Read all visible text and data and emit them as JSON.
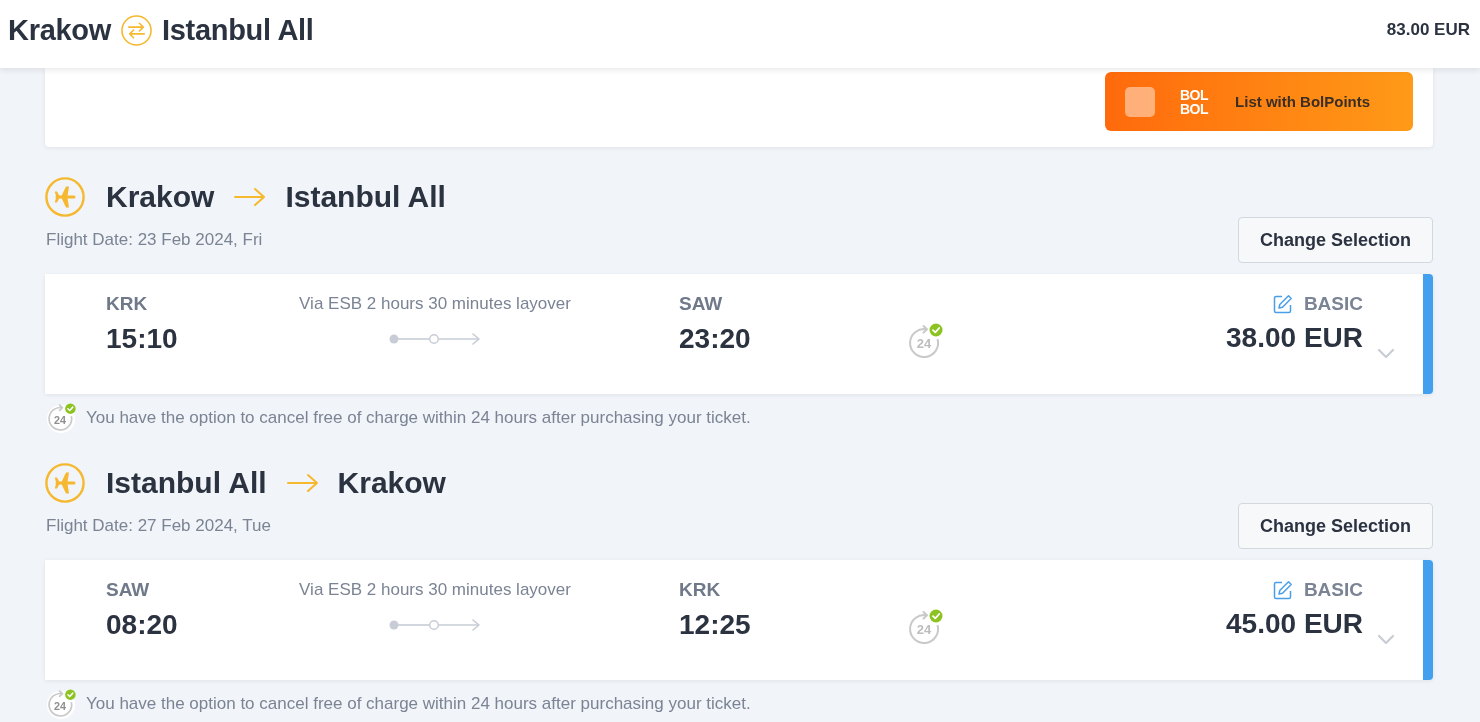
{
  "header": {
    "origin": "Krakow",
    "destination": "Istanbul All",
    "total": "83.00 EUR"
  },
  "bolpoints": {
    "logo_lines": [
      "BOL",
      "BOL"
    ],
    "button": "List with BolPoints"
  },
  "legs": [
    {
      "origin": "Krakow",
      "destination": "Istanbul All",
      "date": "Flight Date: 23 Feb 2024, Fri",
      "change_button": "Change Selection",
      "flight": {
        "from_code": "KRK",
        "departure": "15:10",
        "via": "Via ESB 2 hours 30 minutes layover",
        "to_code": "SAW",
        "arrival": "23:20",
        "cancel_badge": "24",
        "fare": "BASIC",
        "price": "38.00 EUR"
      },
      "note": {
        "badge": "24",
        "text": "You have the option to cancel free of charge within 24 hours after purchasing your ticket."
      }
    },
    {
      "origin": "Istanbul All",
      "destination": "Krakow",
      "date": "Flight Date: 27 Feb 2024, Tue",
      "change_button": "Change Selection",
      "flight": {
        "from_code": "SAW",
        "departure": "08:20",
        "via": "Via ESB 2 hours 30 minutes layover",
        "to_code": "KRK",
        "arrival": "12:25",
        "cancel_badge": "24",
        "fare": "BASIC",
        "price": "45.00 EUR"
      },
      "note": {
        "badge": "24",
        "text": "You have the option to cancel free of charge within 24 hours after purchasing your ticket."
      }
    }
  ]
}
